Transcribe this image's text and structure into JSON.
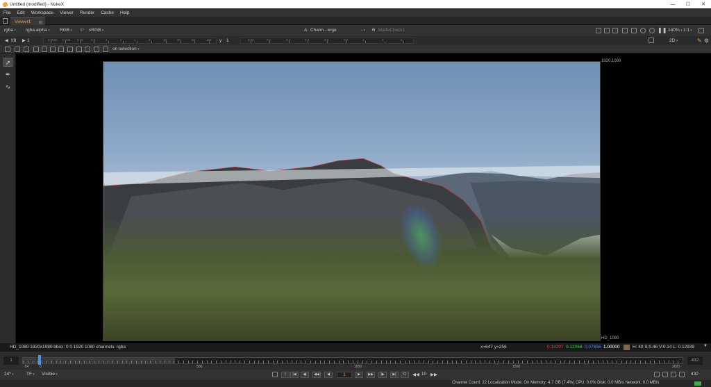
{
  "window": {
    "title": "Untitled (modified) - NukeX",
    "controls": [
      "—",
      "☐",
      "✕"
    ]
  },
  "menu": [
    "File",
    "Edit",
    "Workspace",
    "Viewer",
    "Render",
    "Cache",
    "Help"
  ],
  "tab": {
    "label": "Viewer1",
    "close": "⊠"
  },
  "toolbar1": {
    "layer": "rgba",
    "alpha": "rgba.alpha",
    "display": "RGB",
    "ip": "IP",
    "lut": "sRGB",
    "a_label": "A",
    "a_input": "Chann...erge",
    "a_dash": "-",
    "b_label": "B",
    "b_input": "MatteCheck1",
    "zoom": "140%",
    "ratio": "1:1"
  },
  "toolbar2": {
    "fstop": "f/8",
    "frame": "1",
    "y_label": "y",
    "y_value": "1",
    "view_mode": "2D",
    "ruler_left": [
      "0.0625",
      "0.125",
      "0.25",
      "0.5",
      "1",
      "2",
      "4",
      "8",
      "16",
      "32",
      "64",
      "128"
    ],
    "ruler_right": [
      "0.02",
      "0.1",
      "0.2",
      "0.4",
      "0.6",
      "0.8",
      "1",
      "2",
      "5"
    ]
  },
  "toolbar3": {
    "roi": "on selection"
  },
  "viewer": {
    "format_top": "1920,1080",
    "format_bottom": "HD_1080"
  },
  "infobar": {
    "format": "HD_1080 1920x1080  bbox: 0 0 1920 1080 channels: rgba",
    "coords": "x=647 y=256",
    "r": "0.14297",
    "g": "0.13068",
    "b": "0.07656",
    "a": "1.00000",
    "hsvl": "H: 49 S:0.46 V:0.14  L: 0.12939",
    "colors": {
      "r": "#e04040",
      "g": "#40c040",
      "b": "#4a8ae8",
      "swatch": "#7a6a50"
    }
  },
  "timeline": {
    "in": "1",
    "out": "432",
    "labels": [
      "-54",
      "0",
      "500",
      "1000",
      "1500",
      "2020"
    ],
    "cached_fraction": 0.23,
    "playhead_frame": 1
  },
  "transport": {
    "fps": "24*",
    "tf": "TF",
    "visible": "Visible",
    "current": "1",
    "increment": "10",
    "end": "432",
    "buttons": [
      "I",
      "|◀",
      "◀|",
      "◀◀",
      "◀",
      "▶",
      "▶▶",
      "|▶",
      "▶|",
      "O"
    ]
  },
  "status": {
    "text": "Channel Count: 22  Localization Mode: On  Memory: 4.7 GB (7.4%)  CPU: 0.0%  Disk: 0.0 MB/s  Network: 0.0 MB/s"
  }
}
